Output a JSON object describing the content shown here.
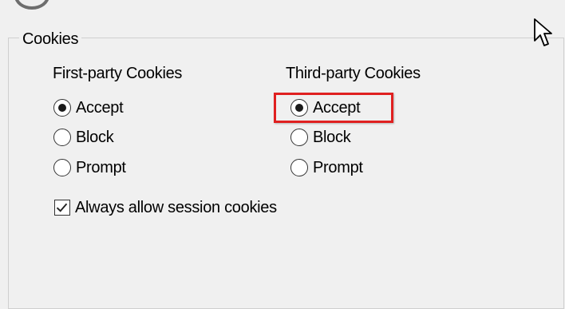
{
  "cookies": {
    "title": "Cookies",
    "first_party": {
      "title": "First-party Cookies",
      "options": [
        {
          "label": "Accept",
          "selected": true
        },
        {
          "label": "Block",
          "selected": false
        },
        {
          "label": "Prompt",
          "selected": false
        }
      ]
    },
    "third_party": {
      "title": "Third-party Cookies",
      "options": [
        {
          "label": "Accept",
          "selected": true
        },
        {
          "label": "Block",
          "selected": false
        },
        {
          "label": "Prompt",
          "selected": false
        }
      ]
    },
    "session": {
      "label": "Always allow session cookies",
      "checked": true
    }
  },
  "colors": {
    "highlight": "#e02020",
    "background": "#f0f0f0"
  },
  "icons": {
    "top": "settings-circle-icon",
    "cursor": "mouse-pointer-icon"
  }
}
